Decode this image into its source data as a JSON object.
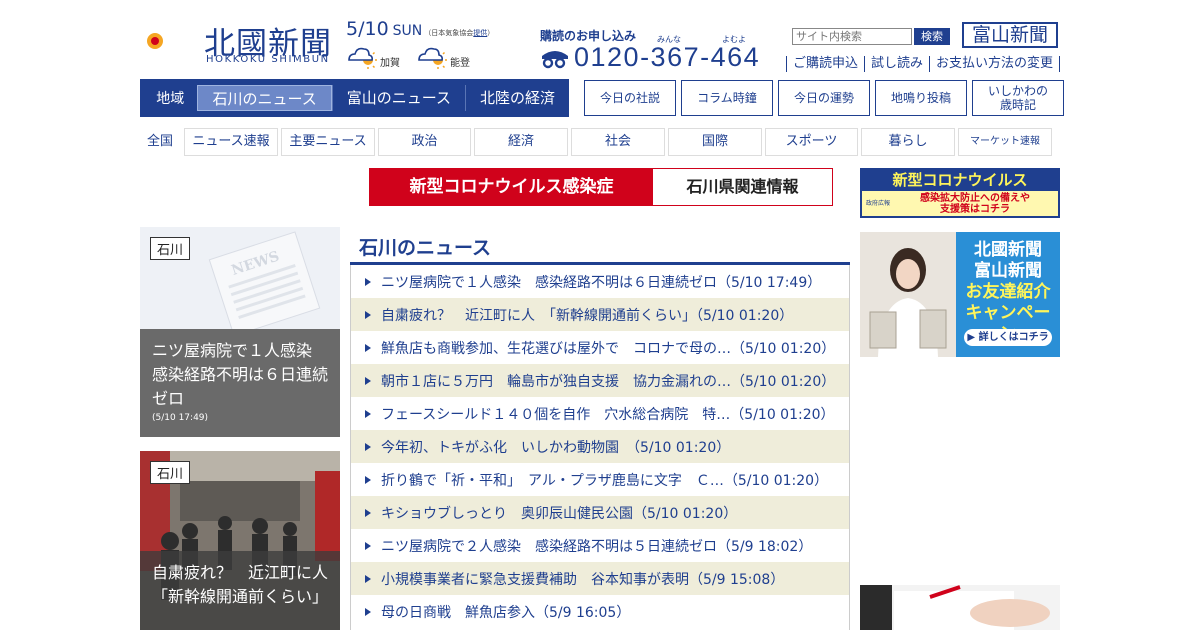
{
  "header": {
    "logo_kanji": "北國新聞",
    "logo_roman": "HOKKOKU SHIMBUN",
    "date": "5/10",
    "day": "SUN",
    "weather_note_prefix": "（日本気象協会",
    "weather_note_link": "提供",
    "weather_note_suffix": "）",
    "weather": [
      {
        "label": "加賀",
        "icon": "cloudy-sunny-icon"
      },
      {
        "label": "能登",
        "icon": "cloudy-sunny-icon"
      }
    ],
    "subscribe_title": "購読のお申し込み",
    "phone_ruby": [
      "みんな",
      "よむよ"
    ],
    "phone_number": "0120-367-464",
    "search_placeholder": "サイト内検索",
    "search_button": "検索",
    "toyama_link": "富山新聞",
    "util_links": [
      "ご購読申込",
      "試し読み",
      "お支払い方法の変更"
    ]
  },
  "region_nav": {
    "label": "地域",
    "tabs": [
      {
        "label": "石川のニュース",
        "active": true
      },
      {
        "label": "富山のニュース",
        "active": false
      },
      {
        "label": "北陸の経済",
        "active": false
      }
    ]
  },
  "side_buttons": [
    "今日の社説",
    "コラム時鐘",
    "今日の運勢",
    "地鳴り投稿",
    "いしかわの\n歳時記"
  ],
  "category_nav": {
    "first": "全国",
    "items": [
      "ニュース速報",
      "主要ニュース",
      "政治",
      "経済",
      "社会",
      "国際",
      "スポーツ",
      "暮らし",
      "マーケット速報"
    ]
  },
  "covid_banner": {
    "left": "新型コロナウイルス感染症",
    "right": "石川県関連情報"
  },
  "ad_covid": {
    "top": "新型コロナウイルス",
    "logo": "政府広報",
    "line1": "感染拡大防止への備えや",
    "line2": "支援策はコチラ"
  },
  "feature_cards": [
    {
      "tag": "石川",
      "title": "ニツ屋病院で１人感染　感染経路不明は６日連続ゼロ",
      "time": "(5/10 17:49)"
    },
    {
      "tag": "石川",
      "title": "自粛疲れ？　近江町に人　「新幹線開通前くらい」",
      "time": ""
    }
  ],
  "news_section": {
    "title": "石川のニュース",
    "items": [
      "ニツ屋病院で１人感染　感染経路不明は６日連続ゼロ（5/10 17:49）",
      "自粛疲れ？　近江町に人　「新幹線開通前くらい」（5/10 01:20）",
      "鮮魚店も商戦参加、生花選びは屋外で　コロナで母の…（5/10 01:20）",
      "朝市１店に５万円　輪島市が独自支援　協力金漏れの…（5/10 01:20）",
      "フェースシールド１４０個を自作　穴水総合病院　特…（5/10 01:20）",
      "今年初、トキがふ化　いしかわ動物園　（5/10 01:20）",
      "折り鶴で「祈・平和」　アル・プラザ鹿島に文字　Ｃ…（5/10 01:20）",
      "キショウブしっとり　奥卯辰山健民公園（5/10 01:20）",
      "ニツ屋病院で２人感染　感染経路不明は５日連続ゼロ（5/9 18:02）",
      "小規模事業者に緊急支援費補助　谷本知事が表明（5/9 15:08）",
      "母の日商戦　鮮魚店参入（5/9 16:05）"
    ]
  },
  "ad_friend": {
    "line1": "北國新聞",
    "line2": "富山新聞",
    "line3": "お友達紹介",
    "line4": "キャンペーン",
    "button": "▶ 詳しくはコチラ"
  },
  "colors": {
    "brand": "#1f3f8f",
    "covid_red": "#d0021b",
    "row_alt": "#efedda"
  }
}
